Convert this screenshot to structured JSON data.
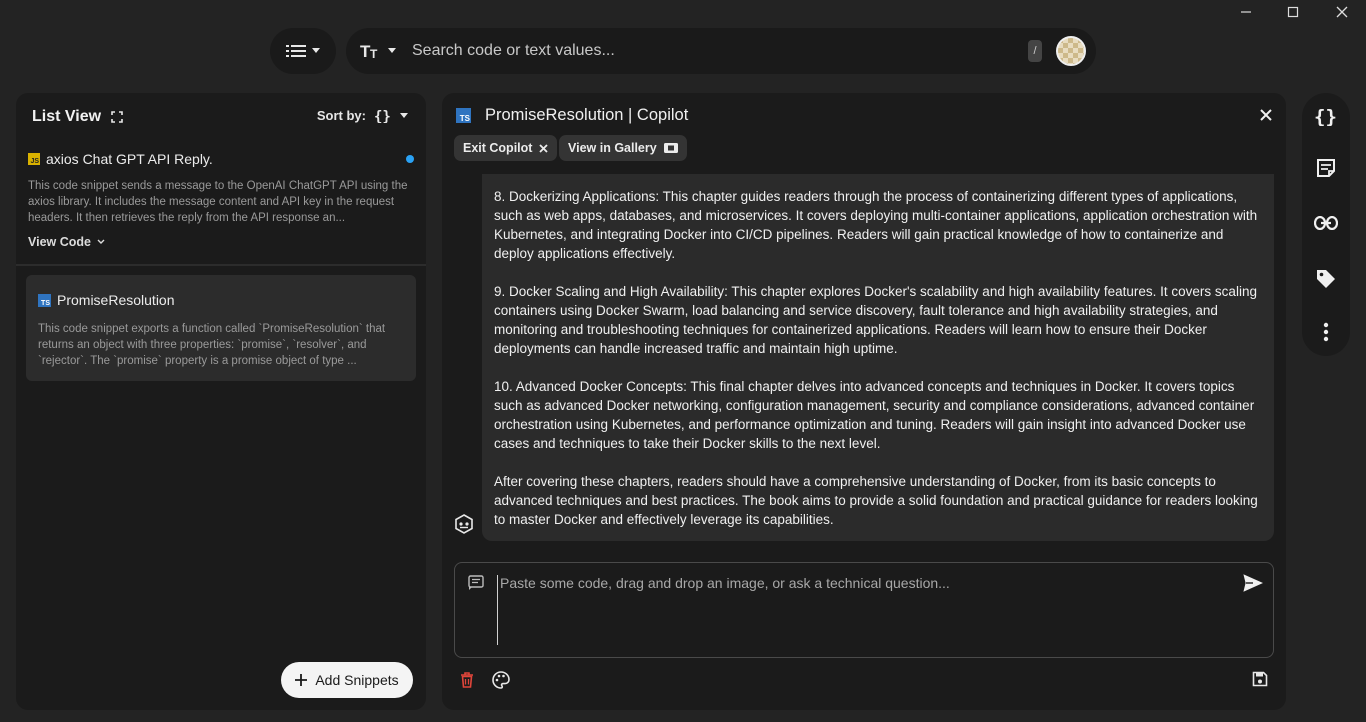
{
  "window": {
    "minimize_icon": "minimize-icon",
    "maximize_icon": "maximize-icon",
    "close_icon": "close-icon"
  },
  "topbar": {
    "list_menu_icon": "list-icon",
    "text_mode_icon": "text-format-icon",
    "search_placeholder": "Search code or text values...",
    "shortcut_key": "/"
  },
  "left_panel": {
    "title": "List View",
    "sort_label": "Sort by:",
    "snippets": [
      {
        "language_badge": "JS",
        "title": "axios Chat GPT API Reply.",
        "description": "This code snippet sends a message to the OpenAI ChatGPT API using the axios library. It includes the message content and API key in the request headers. It then retrieves the reply from the API response an...",
        "view_code_label": "View Code",
        "unread": true
      },
      {
        "language_badge": "TS",
        "title": "PromiseResolution",
        "description": "This code snippet exports a function called `PromiseResolution` that returns an object with three properties: `promise`, `resolver`, and `rejector`. The `promise` property is a promise object of type ...",
        "selected": true
      }
    ],
    "add_button_label": "Add Snippets"
  },
  "main_panel": {
    "language_badge": "TS",
    "title": "PromiseResolution | Copilot",
    "chips": {
      "exit_label": "Exit Copilot",
      "gallery_label": "View in Gallery"
    },
    "chat_paragraphs": [
      "8. Dockerizing Applications: This chapter guides readers through the process of containerizing different types of applications, such as web apps, databases, and microservices. It covers deploying multi-container applications, application orchestration with Kubernetes, and integrating Docker into CI/CD pipelines. Readers will gain practical knowledge of how to containerize and deploy applications effectively.",
      "9. Docker Scaling and High Availability: This chapter explores Docker's scalability and high availability features. It covers scaling containers using Docker Swarm, load balancing and service discovery, fault tolerance and high availability strategies, and monitoring and troubleshooting techniques for containerized applications. Readers will learn how to ensure their Docker deployments can handle increased traffic and maintain high uptime.",
      "10. Advanced Docker Concepts: This final chapter delves into advanced concepts and techniques in Docker. It covers topics such as advanced Docker networking, configuration management, security and compliance considerations, advanced container orchestration using Kubernetes, and performance optimization and tuning. Readers will gain insight into advanced Docker use cases and techniques to take their Docker skills to the next level.",
      "After covering these chapters, readers should have a comprehensive understanding of Docker, from its basic concepts to advanced techniques and best practices. The book aims to provide a solid foundation and practical guidance for readers looking to master Docker and effectively leverage its capabilities."
    ],
    "composer_placeholder": "Paste some code, drag and drop an image, or ask a technical question..."
  },
  "right_rail": {
    "items": [
      "code-braces-icon",
      "notes-icon",
      "link-icon",
      "tag-icon",
      "more-vertical-icon"
    ]
  },
  "colors": {
    "background": "#232323",
    "panel": "#1b1b1b",
    "unread_dot": "#2aa2f5",
    "delete_red": "#e0453a",
    "ts_badge": "#2f74c0",
    "js_badge": "#d9b200"
  }
}
